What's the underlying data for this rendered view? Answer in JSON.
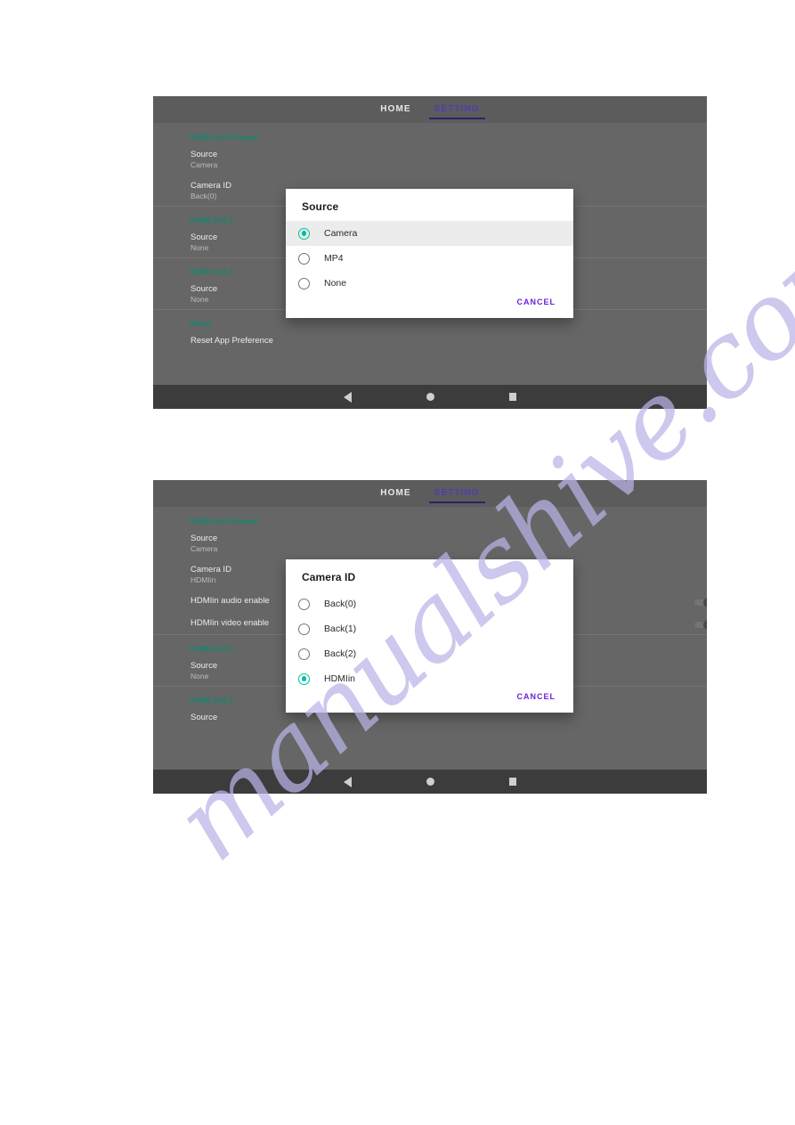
{
  "watermark": {
    "text": "manualshive.com"
  },
  "colors": {
    "background_gray": "#666666",
    "header_gray": "#5c5c5c",
    "navbar_gray": "#3c3c3c",
    "group_title_teal": "#0f8a6e",
    "radio_selected_teal": "#00bfa5",
    "cancel_purple": "#6b21d6",
    "tab_active_purple": "#4a3fb5"
  },
  "screenshots": [
    {
      "id": "screenshot-source-dialog",
      "tabs": [
        {
          "label": "HOME",
          "active": false
        },
        {
          "label": "SETTING",
          "active": true
        }
      ],
      "groups": [
        {
          "title": "HDMI Out Primary",
          "prefs": [
            {
              "title": "Source",
              "summary": "Camera",
              "toggle": false
            },
            {
              "title": "Camera ID",
              "summary": "Back(0)",
              "toggle": false
            }
          ]
        },
        {
          "title": "HDMI Out 2",
          "prefs": [
            {
              "title": "Source",
              "summary": "None",
              "toggle": false
            }
          ]
        },
        {
          "title": "HDMI Out 3",
          "prefs": [
            {
              "title": "Source",
              "summary": "None",
              "toggle": false
            }
          ]
        },
        {
          "title": "Reset",
          "prefs": [
            {
              "title": "Reset App Preference",
              "summary": "",
              "toggle": false
            }
          ]
        }
      ],
      "dialog": {
        "title": "Source",
        "options": [
          {
            "label": "Camera",
            "selected": true
          },
          {
            "label": "MP4",
            "selected": false
          },
          {
            "label": "None",
            "selected": false
          }
        ],
        "cancel_label": "CANCEL"
      },
      "navbar": {
        "back": "back-icon",
        "home": "home-icon",
        "recents": "recents-icon"
      }
    },
    {
      "id": "screenshot-camera-id-dialog",
      "tabs": [
        {
          "label": "HOME",
          "active": false
        },
        {
          "label": "SETTING",
          "active": true
        }
      ],
      "groups": [
        {
          "title": "HDMI Out Primary",
          "prefs": [
            {
              "title": "Source",
              "summary": "Camera",
              "toggle": false
            },
            {
              "title": "Camera ID",
              "summary": "HDMIin",
              "toggle": false
            },
            {
              "title": "HDMIin audio enable",
              "summary": "",
              "toggle": true
            },
            {
              "title": "HDMIin video enable",
              "summary": "",
              "toggle": true
            }
          ]
        },
        {
          "title": "HDMI Out 2",
          "prefs": [
            {
              "title": "Source",
              "summary": "None",
              "toggle": false
            }
          ]
        },
        {
          "title": "HDMI Out 3",
          "prefs": [
            {
              "title": "Source",
              "summary": "",
              "toggle": false
            }
          ]
        }
      ],
      "dialog": {
        "title": "Camera ID",
        "options": [
          {
            "label": "Back(0)",
            "selected": false
          },
          {
            "label": "Back(1)",
            "selected": false
          },
          {
            "label": "Back(2)",
            "selected": false
          },
          {
            "label": "HDMIin",
            "selected": true
          }
        ],
        "cancel_label": "CANCEL"
      },
      "navbar": {
        "back": "back-icon",
        "home": "home-icon",
        "recents": "recents-icon"
      }
    }
  ]
}
